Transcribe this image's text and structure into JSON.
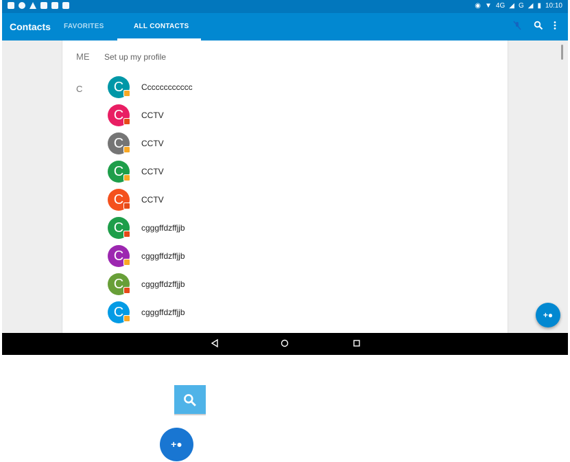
{
  "status_bar": {
    "time": "10:10",
    "network": "4G",
    "network2": "G"
  },
  "app_bar": {
    "title": "Contacts",
    "tabs": [
      {
        "label": "FAVORITES",
        "selected": false
      },
      {
        "label": "ALL CONTACTS",
        "selected": true
      }
    ],
    "icons": [
      "microphone-off-icon",
      "search-icon",
      "more-vert-icon"
    ]
  },
  "me_section": {
    "label": "ME",
    "text": "Set up my profile"
  },
  "section_letter": "C",
  "contacts": [
    {
      "initial": "C",
      "name": "Cccccccccccc",
      "color": "#0097a7",
      "badge": "#f9a825"
    },
    {
      "initial": "C",
      "name": "CCTV",
      "color": "#e91e63",
      "badge": "#e64a19"
    },
    {
      "initial": "C",
      "name": "CCTV",
      "color": "#757575",
      "badge": "#f9a825"
    },
    {
      "initial": "C",
      "name": "CCTV",
      "color": "#1e9e4a",
      "badge": "#f9a825"
    },
    {
      "initial": "C",
      "name": "CCTV",
      "color": "#f4511e",
      "badge": "#e64a19"
    },
    {
      "initial": "C",
      "name": "cgggffdzffjjb",
      "color": "#1e9e4a",
      "badge": "#e64a19"
    },
    {
      "initial": "C",
      "name": "cgggffdzffjjb",
      "color": "#9c27b0",
      "badge": "#f9a825"
    },
    {
      "initial": "C",
      "name": "cgggffdzffjjb",
      "color": "#689f38",
      "badge": "#e64a19"
    },
    {
      "initial": "C",
      "name": "cgggffdzffjjb",
      "color": "#039be5",
      "badge": "#f9a825"
    }
  ],
  "fab": {
    "icon": "add-contact-icon",
    "color": "#0288d1"
  },
  "nav_bar": {
    "icons": [
      "back-icon",
      "home-icon",
      "recents-icon"
    ]
  },
  "reference_icons": [
    {
      "icon": "search-icon",
      "color": "#4fb3e8"
    },
    {
      "icon": "add-contact-icon",
      "color": "#1976d2"
    }
  ],
  "colors": {
    "primary": "#0288d1",
    "status_bar": "#0277bd"
  }
}
